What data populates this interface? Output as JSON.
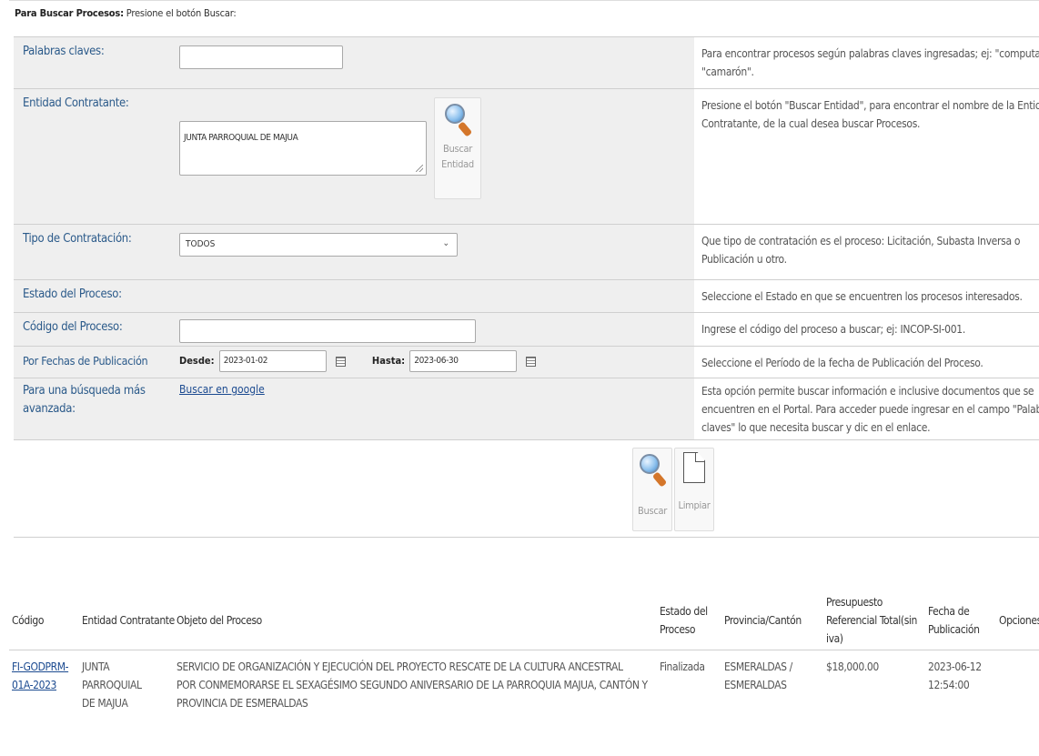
{
  "intro": {
    "bold": "Para Buscar Procesos:",
    "text": " Presione el botón Buscar:"
  },
  "form": {
    "keywords": {
      "label": "Palabras claves:",
      "value": "",
      "help1": "Para encontrar procesos según palabras claves ingresadas; ej: \"computador\"",
      "help2": "\"camarón\"."
    },
    "entity": {
      "label": "Entidad Contratante:",
      "value": "JUNTA PARROQUIAL DE MAJUA",
      "button1": "Buscar",
      "button2": "Entidad",
      "help1": "Presione el botón \"Buscar Entidad\", para encontrar el nombre de la Entidad",
      "help2": "Contratante, de la cual desea buscar Procesos."
    },
    "type": {
      "label": "Tipo de Contratación:",
      "value": "TODOS",
      "help1": "Que tipo de contratación es el proceso: Licitación, Subasta Inversa o",
      "help2": "Publicación u otro."
    },
    "state": {
      "label": "Estado del Proceso:",
      "help": "Seleccione el Estado en que se encuentren los procesos interesados."
    },
    "code": {
      "label": "Código del Proceso:",
      "value": "",
      "help": "Ingrese el código del proceso a buscar; ej: INCOP-SI-001."
    },
    "dates": {
      "label": "Por Fechas de Publicación",
      "from_label": "Desde:",
      "from": "2023-01-02",
      "to_label": "Hasta:",
      "to": "2023-06-30",
      "help": "Seleccione el Período de la fecha de Publicación del Proceso."
    },
    "advanced": {
      "label1": "Para una búsqueda más",
      "label2": "avanzada:",
      "link": "Buscar en google",
      "help1": "Esta opción permite buscar información e inclusive documentos que se",
      "help2": "encuentren en el Portal. Para acceder puede ingresar en el campo \"Palabras",
      "help3": "claves\" lo que necesita buscar y dic en el enlace."
    },
    "search_button": "Buscar",
    "clear_button": "Limpiar"
  },
  "results": {
    "headers": {
      "code": "Código",
      "entity": "Entidad Contratante",
      "object": "Objeto del Proceso",
      "state1": "Estado del",
      "state2": "Proceso",
      "province": "Provincia/Cantón",
      "budget1": "Presupuesto",
      "budget2": "Referencial Total(sin",
      "budget3": "iva)",
      "date1": "Fecha de",
      "date2": "Publicación",
      "options": "Opciones"
    },
    "rows": [
      {
        "code1": "FI-GODPRM-",
        "code2": "01A-2023",
        "entity1": "JUNTA PARROQUIAL",
        "entity2": "DE MAJUA",
        "object1": "SERVICIO DE ORGANIZACIÓN Y EJECUCIÓN DEL PROYECTO RESCATE DE LA CULTURA ANCESTRAL",
        "object2": "POR CONMEMORARSE EL SEXAGÉSIMO SEGUNDO ANIVERSARIO DE LA PARROQUIA MAJUA, CANTÓN Y",
        "object3": "PROVINCIA DE ESMERALDAS",
        "state": "Finalizada",
        "province1": "ESMERALDAS /",
        "province2": "ESMERALDAS",
        "budget": "$18,000.00",
        "date1": "2023-06-12",
        "date2": "12:54:00"
      }
    ]
  }
}
